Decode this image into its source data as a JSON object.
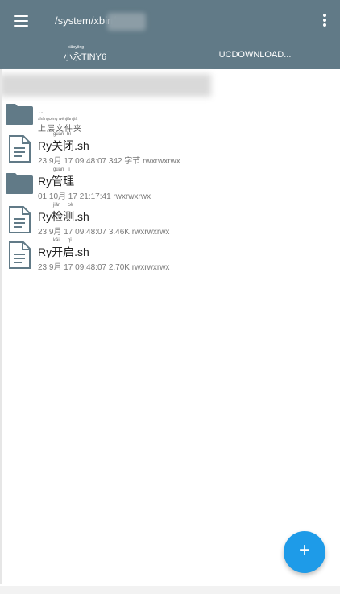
{
  "appbar": {
    "path": "/system/xbin/",
    "tabs": [
      {
        "label": "小永TINY6",
        "pinyin": "xiǎoyǒng"
      },
      {
        "label": "UCDOWNLOAD..."
      }
    ]
  },
  "files": [
    {
      "name": "..",
      "meta": "上层文件夹",
      "meta_pinyin": "shàngcéng wénjiàn jiā",
      "type": "folder"
    },
    {
      "name": "Ry关闭.sh",
      "name_pinyin": [
        "guān",
        "bì"
      ],
      "meta": "23 9月 17 09:48:07  342 字节  rwxrwxrwx",
      "type": "file"
    },
    {
      "name": "Ry管理",
      "name_pinyin": [
        "guǎn",
        "lǐ"
      ],
      "meta": "01 10月 17 21:17:41  rwxrwxrwx",
      "type": "folder"
    },
    {
      "name": "Ry检测.sh",
      "name_pinyin": [
        "jiǎn",
        "cè"
      ],
      "meta": "23 9月 17 09:48:07  3.46K  rwxrwxrwx",
      "type": "file"
    },
    {
      "name": "Ry开启.sh",
      "name_pinyin": [
        "kāi",
        "qǐ"
      ],
      "meta": "23 9月 17 09:48:07  2.70K  rwxrwxrwx",
      "type": "file"
    }
  ],
  "fab": {
    "label": "+"
  },
  "colors": {
    "appbar": "#617a87",
    "folder": "#617a87",
    "fab": "#1e9be8"
  }
}
